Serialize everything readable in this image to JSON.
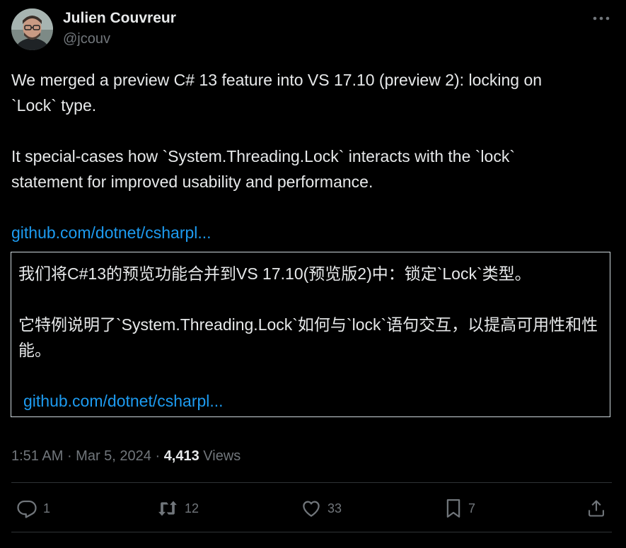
{
  "author": {
    "name": "Julien Couvreur",
    "handle": "@jcouv"
  },
  "tweet": {
    "line1": "We merged a preview C# 13 feature into VS 17.10 (preview 2): locking on",
    "line2": "`Lock` type.",
    "line3": "It special-cases how `System.Threading.Lock` interacts with the `lock`",
    "line4": "statement for improved usability and performance.",
    "link": "github.com/dotnet/csharpl..."
  },
  "translation": {
    "para1": "我们将C#13的预览功能合并到VS 17.10(预览版2)中：锁定`Lock`类型。",
    "para2": "它特例说明了`System.Threading.Lock`如何与`lock`语句交互，以提高可用性和性能。",
    "link": "github.com/dotnet/csharpl..."
  },
  "meta": {
    "time": "1:51 AM",
    "sep1": " · ",
    "date": "Mar 5, 2024",
    "sep2": " · ",
    "views_count": "4,413",
    "views_label": " Views"
  },
  "actions": {
    "replies": "1",
    "reposts": "12",
    "likes": "33",
    "bookmarks": "7"
  },
  "icons": {
    "more": "more-horizontal-icon",
    "reply": "reply-icon",
    "repost": "repost-icon",
    "like": "heart-icon",
    "bookmark": "bookmark-icon",
    "share": "share-icon"
  },
  "colors": {
    "background": "#000000",
    "text": "#e7e9ea",
    "secondary": "#71767b",
    "link": "#1d9bf0",
    "divider": "#2f3336"
  }
}
